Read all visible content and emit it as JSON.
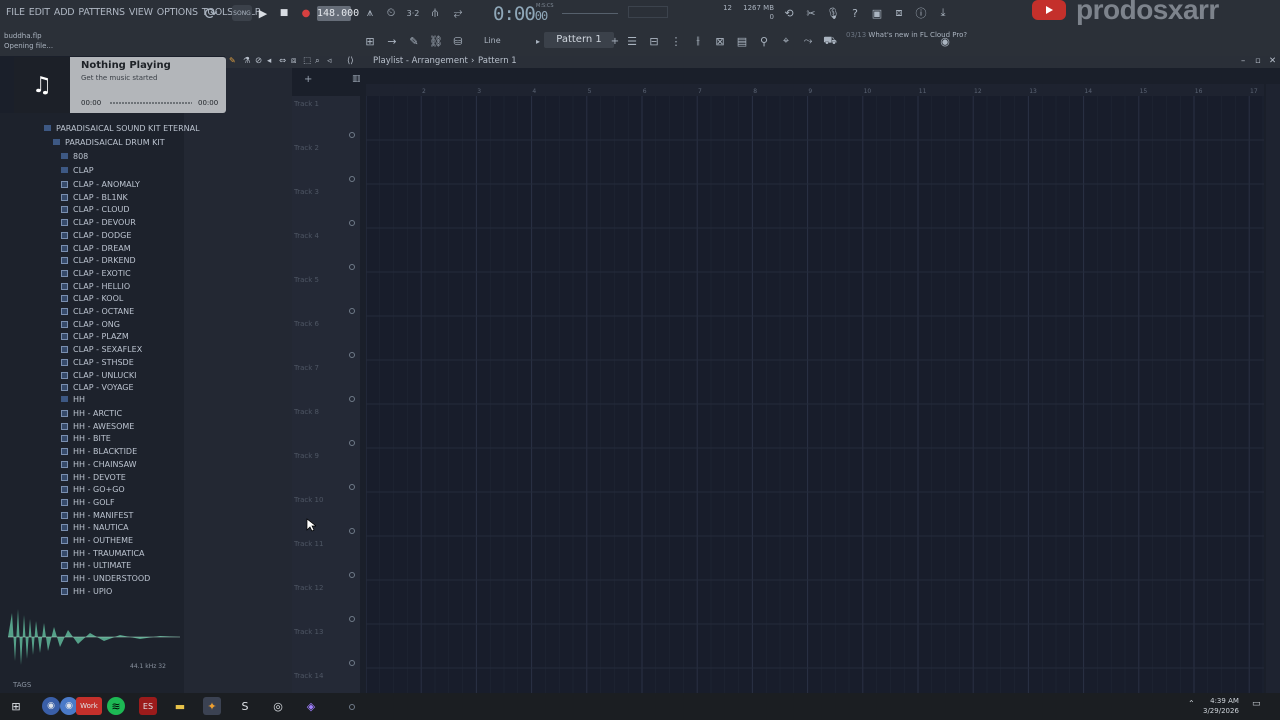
{
  "menu": [
    "FILE",
    "EDIT",
    "ADD",
    "PATTERNS",
    "VIEW",
    "OPTIONS",
    "TOOLS",
    "HELP"
  ],
  "hint": {
    "line1": "buddha.flp",
    "line2": "Opening file..."
  },
  "tempo": "148.000",
  "time": {
    "main": "0:00",
    "sub": "00",
    "label": "M:S:CS"
  },
  "cpu": {
    "voices": "12",
    "mem": "1267 MB",
    "poly": "0"
  },
  "pattern": "Pattern 1",
  "snap": "Line",
  "news": {
    "date": "03/13",
    "text": "What's new in FL Cloud Pro?"
  },
  "brand": "prodosxarr",
  "notification": {
    "title": "Nothing Playing",
    "subtitle": "Get the music started",
    "time_start": "00:00",
    "time_end": "00:00"
  },
  "playlist": {
    "title": "Playlist - Arrangement",
    "pattern": "Pattern 1"
  },
  "ruler": [
    "2",
    "3",
    "4",
    "5",
    "6",
    "7",
    "8",
    "9",
    "10",
    "11",
    "12",
    "13",
    "14",
    "15",
    "16",
    "17"
  ],
  "tracks": [
    "Track 1",
    "Track 2",
    "Track 3",
    "Track 4",
    "Track 5",
    "Track 6",
    "Track 7",
    "Track 8",
    "Track 9",
    "Track 10",
    "Track 11",
    "Track 12",
    "Track 13",
    "Track 14"
  ],
  "browser": {
    "root": "PARADISAICAL SOUND KIT ETERNAL",
    "kit": "PARADISAICAL DRUM KIT",
    "folders": [
      "808",
      "CLAP",
      "HH"
    ],
    "clap": [
      "CLAP - ANOMALY",
      "CLAP - BL1NK",
      "CLAP - CLOUD",
      "CLAP - DEVOUR",
      "CLAP - DODGE",
      "CLAP - DREAM",
      "CLAP - DRKEND",
      "CLAP - EXOTIC",
      "CLAP - HELLIO",
      "CLAP - KOOL",
      "CLAP - OCTANE",
      "CLAP - ONG",
      "CLAP - PLAZM",
      "CLAP - SEXAFLEX",
      "CLAP - STHSDE",
      "CLAP - UNLUCKI",
      "CLAP - VOYAGE"
    ],
    "hh": [
      "HH - ARCTIC",
      "HH - AWESOME",
      "HH - BITE",
      "HH - BLACKTIDE",
      "HH - CHAINSAW",
      "HH - DEVOTE",
      "HH - GO+GO",
      "HH - GOLF",
      "HH - MANIFEST",
      "HH - NAUTICA",
      "HH - OUTHEME",
      "HH - TRAUMATICA",
      "HH - ULTIMATE",
      "HH - UNDERSTOOD",
      "HH - UPIO"
    ]
  },
  "sample_info": "44.1 kHz 32",
  "tags": "TAGS",
  "clock": {
    "time": "4:39 AM",
    "date": "3/29/2026"
  },
  "taskbar_label": "Work",
  "colors": {
    "accent": "#c4302b",
    "grid": "#181d2b",
    "panel": "#1d222c"
  }
}
